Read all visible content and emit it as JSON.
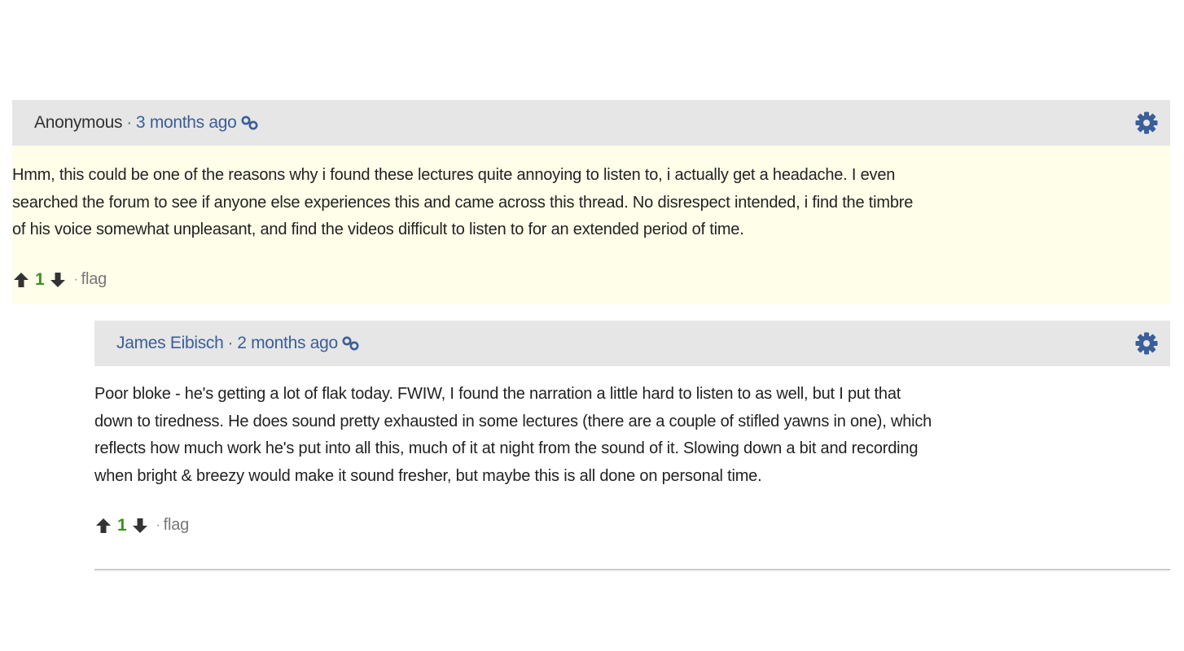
{
  "comments": [
    {
      "author": "Anonymous",
      "separator": "·",
      "time": "3 months ago",
      "text_lines": [
        "Hmm, this could be one of the reasons why i found these lectures quite annoying to listen to, i actually get a headache. I even",
        "searched the forum to see if anyone else experiences this and came across this thread. No disrespect intended, i find the timbre",
        "of his voice somewhat unpleasant, and find the videos difficult to listen to for an extended period of time."
      ],
      "score": "1",
      "flag_label": "flag",
      "flag_separator": "·"
    },
    {
      "author": "James Eibisch",
      "separator": "·",
      "time": "2 months ago",
      "text_lines": [
        "Poor bloke - he's getting a lot of flak today. FWIW, I found the narration a little hard to listen to as well, but I put that",
        "down to tiredness. He does sound pretty exhausted in some lectures (there are a couple of stifled yawns in one), which",
        "reflects how much work he's put into all this, much of it at night from the sound of it. Slowing down a bit and recording",
        "when bright & breezy would make it sound fresher, but maybe this is all done on personal time."
      ],
      "score": "1",
      "flag_label": "flag",
      "flag_separator": "·"
    }
  ],
  "colors": {
    "header_bg": "#e6e6e6",
    "highlight_bg": "#fffee9",
    "link": "#3a5f99",
    "score": "#3e8f21",
    "gear": "#3a5f99"
  },
  "icons": {
    "permalink": "link-icon",
    "settings": "gear-icon",
    "upvote": "arrow-up-icon",
    "downvote": "arrow-down-icon"
  }
}
